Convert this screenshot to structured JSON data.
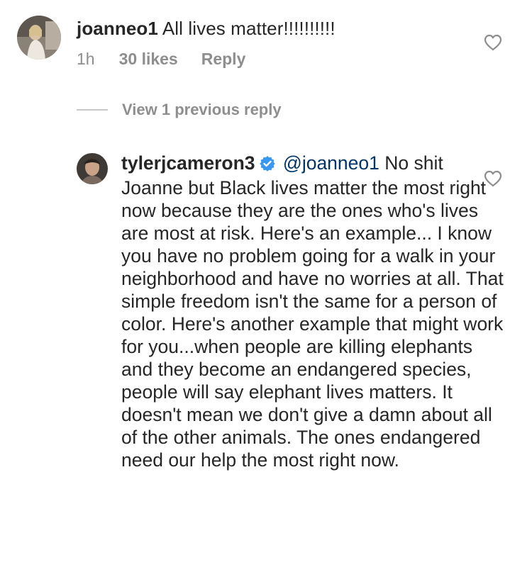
{
  "comment": {
    "username": "joanneo1",
    "text": "All lives matter!!!!!!!!!!",
    "time": "1h",
    "likes": "30 likes",
    "reply_label": "Reply"
  },
  "view_previous": {
    "label": "View 1 previous reply"
  },
  "reply": {
    "username": "tylerjcameron3",
    "mention": "@joanneo1",
    "text": "No shit Joanne but Black lives matter the most right now because they are the ones who's lives are most at risk. Here's an example... I know you have no problem going for a walk in your neighborhood and have no worries at all. That simple freedom isn't the same for a person of color. Here's another example that might work for you...when people are killing elephants and they become an endangered species, people will say elephant lives matters. It doesn't mean we don't give a damn about all of the other animals. The ones endangered need our help the most right now."
  },
  "colors": {
    "text": "#262626",
    "secondary": "#8e8e8e",
    "mention": "#003569",
    "verified": "#3897f0"
  }
}
